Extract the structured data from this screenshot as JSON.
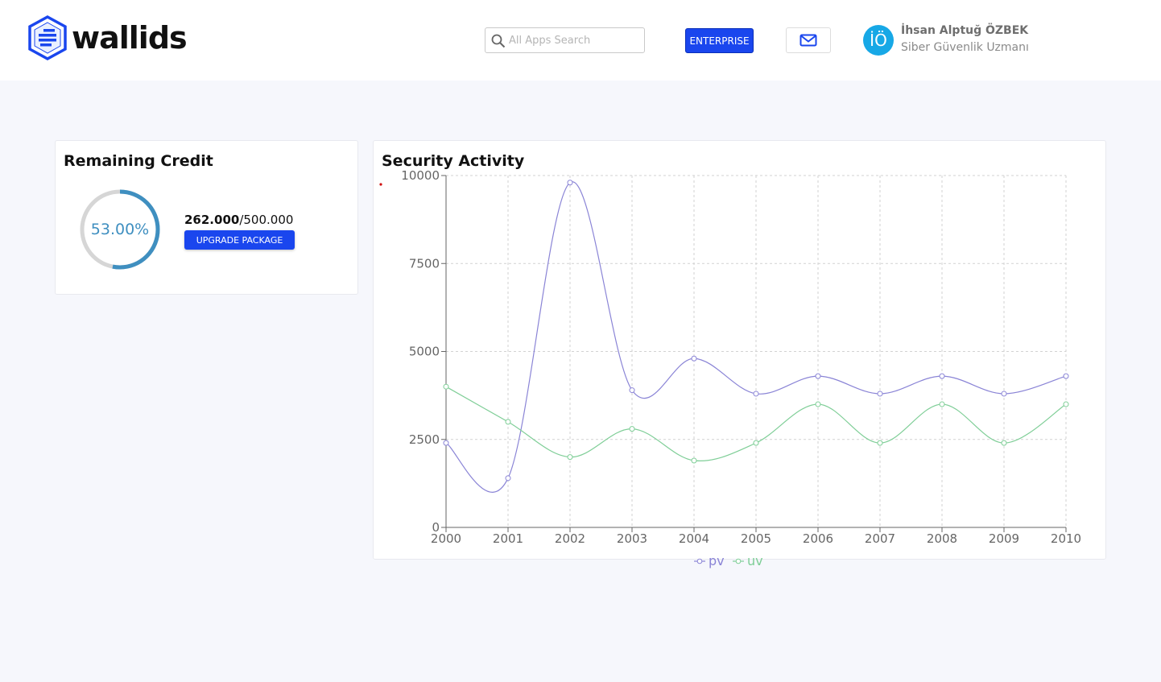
{
  "header": {
    "brand": "wallids",
    "search_placeholder": "All Apps Search",
    "enterprise_label": "ENTERPRISE",
    "user": {
      "initials": "İÖ",
      "name": "İhsan Alptuğ ÖZBEK",
      "role": "Siber Güvenlik Uzmanı"
    }
  },
  "colors": {
    "accent": "#1a46ee",
    "donut": "#3f8fc0",
    "pv": "#8a84d6",
    "uv": "#7fce97"
  },
  "credit": {
    "title": "Remaining Credit",
    "percent_label": "53.00%",
    "percent": 53,
    "used": "262.000",
    "separator": "/",
    "total": "500.000",
    "upgrade_label": "UPGRADE PACKAGE"
  },
  "activity": {
    "title": "Security Activity"
  },
  "chart_data": {
    "type": "line",
    "title": "Security Activity",
    "x": [
      "2000",
      "2001",
      "2002",
      "2003",
      "2004",
      "2005",
      "2006",
      "2007",
      "2008",
      "2009",
      "2010"
    ],
    "series": [
      {
        "name": "pv",
        "values": [
          2400,
          1400,
          9800,
          3900,
          4800,
          3800,
          4300,
          3800,
          4300,
          3800,
          4300
        ]
      },
      {
        "name": "uv",
        "values": [
          4000,
          3000,
          2000,
          2800,
          1900,
          2400,
          3500,
          2400,
          3500,
          2400,
          3500
        ]
      }
    ],
    "yticks": [
      "0",
      "2500",
      "5000",
      "7500",
      "10000"
    ],
    "ylim": [
      0,
      10000
    ],
    "grid": true,
    "legend_position": "bottom-center",
    "smooth": true
  }
}
